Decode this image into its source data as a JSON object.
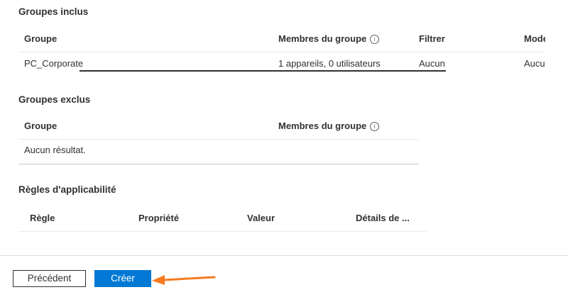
{
  "included": {
    "title": "Groupes inclus",
    "columns": [
      "Groupe",
      "Membres du groupe",
      "Filtrer",
      "Mode"
    ],
    "info_icon": "info-icon",
    "row": {
      "group": "PC_Corporate",
      "members": "1 appareils, 0 utilisateurs",
      "filter": "Aucun",
      "mode": "Aucun"
    }
  },
  "excluded": {
    "title": "Groupes exclus",
    "columns": [
      "Groupe",
      "Membres du groupe"
    ],
    "info_icon": "info-icon",
    "empty_text": "Aucun résultat."
  },
  "applicability": {
    "title": "Règles d'applicabilité",
    "columns": [
      "Règle",
      "Propriété",
      "Valeur",
      "Détails de ..."
    ]
  },
  "footer": {
    "previous_label": "Précédent",
    "create_label": "Créer"
  },
  "colors": {
    "primary": "#0078d4",
    "annotation_arrow": "#f47b20"
  }
}
